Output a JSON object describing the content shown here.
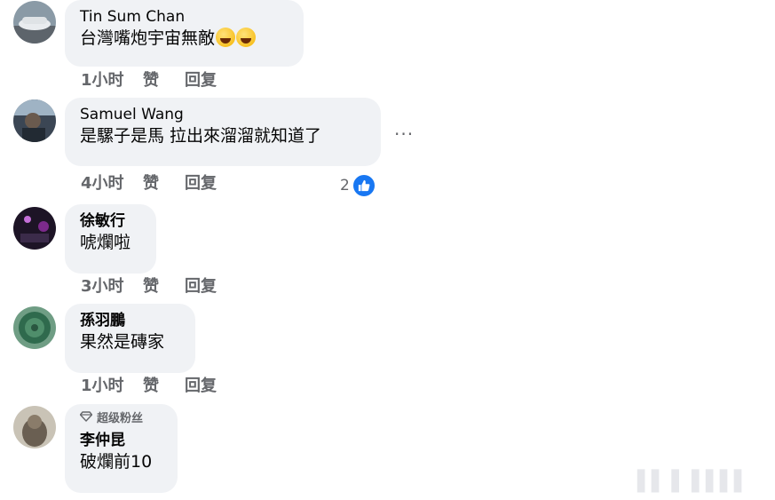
{
  "comments": [
    {
      "author": "Tin Sum Chan",
      "text": "台灣嘴炮宇宙無敵",
      "time": "1小时",
      "like_label": "赞",
      "reply_label": "回复",
      "emoji_icons": [
        "rolling-laughing-emoji-icon",
        "rolling-laughing-emoji-icon"
      ]
    },
    {
      "author": "Samuel Wang",
      "text": "是騾子是馬 拉出來溜溜就知道了",
      "time": "4小时",
      "like_label": "赞",
      "reply_label": "回复",
      "more_label": "···",
      "reaction_count": "2",
      "reaction_icon": "like-icon"
    },
    {
      "author": "徐敏行",
      "text": "唬爛啦",
      "time": "3小时",
      "like_label": "赞",
      "reply_label": "回复"
    },
    {
      "author": "孫羽鵬",
      "text": "果然是磚家",
      "time": "1小时",
      "like_label": "赞",
      "reply_label": "回复"
    },
    {
      "badge": "超级粉丝",
      "badge_icon": "diamond-icon",
      "author": "李仲昆",
      "text": "破爛前10"
    }
  ],
  "colors": {
    "bubble": "#f0f2f5",
    "meta": "#65676b",
    "like_blue": "#1877f2"
  }
}
